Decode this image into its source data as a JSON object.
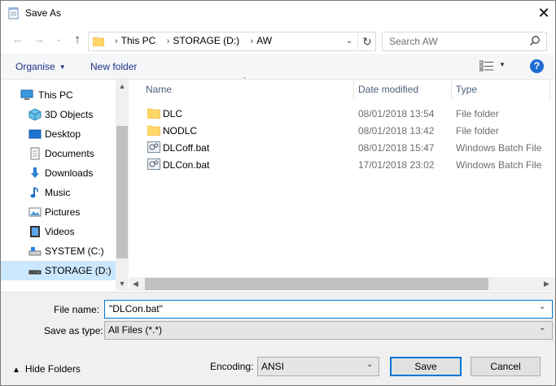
{
  "window": {
    "title": "Save As",
    "close_glyph": "✕"
  },
  "nav": {
    "back_glyph": "←",
    "forward_glyph": "→",
    "recent_glyph": "⌄",
    "up_glyph": "↑",
    "breadcrumbs": [
      "This PC",
      "STORAGE (D:)",
      "AW"
    ],
    "crumb_sep": "›",
    "search_placeholder": "Search AW"
  },
  "commands": {
    "organise": "Organise",
    "new_folder": "New folder"
  },
  "sidebar": {
    "items": [
      {
        "label": "This PC",
        "icon": "computer-icon",
        "selected": false
      },
      {
        "label": "3D Objects",
        "icon": "3d-objects-icon",
        "selected": false
      },
      {
        "label": "Desktop",
        "icon": "desktop-icon",
        "selected": false
      },
      {
        "label": "Documents",
        "icon": "documents-icon",
        "selected": false
      },
      {
        "label": "Downloads",
        "icon": "downloads-icon",
        "selected": false
      },
      {
        "label": "Music",
        "icon": "music-icon",
        "selected": false
      },
      {
        "label": "Pictures",
        "icon": "pictures-icon",
        "selected": false
      },
      {
        "label": "Videos",
        "icon": "videos-icon",
        "selected": false
      },
      {
        "label": "SYSTEM (C:)",
        "icon": "drive-c-icon",
        "selected": false
      },
      {
        "label": "STORAGE (D:)",
        "icon": "drive-d-icon",
        "selected": true
      }
    ]
  },
  "files": {
    "columns": [
      "Name",
      "Date modified",
      "Type"
    ],
    "rows": [
      {
        "name": "DLC",
        "date": "08/01/2018 13:54",
        "type": "File folder",
        "icon": "folder-icon"
      },
      {
        "name": "NODLC",
        "date": "08/01/2018 13:42",
        "type": "File folder",
        "icon": "folder-icon"
      },
      {
        "name": "DLCoff.bat",
        "date": "08/01/2018 15:47",
        "type": "Windows Batch File",
        "icon": "batch-file-icon"
      },
      {
        "name": "DLCon.bat",
        "date": "17/01/2018 23:02",
        "type": "Windows Batch File",
        "icon": "batch-file-icon"
      }
    ]
  },
  "form": {
    "file_name_label": "File name:",
    "file_name_value": "\"DLCon.bat\"",
    "save_type_label": "Save as type:",
    "save_type_value": "All Files  (*.*)",
    "hide_folders": "Hide Folders",
    "encoding_label": "Encoding:",
    "encoding_value": "ANSI",
    "save_button": "Save",
    "cancel_button": "Cancel"
  },
  "colors": {
    "accent": "#0078d7",
    "selected_bg": "#cce8ff",
    "folder": "#ffd669",
    "link": "#1e3287"
  }
}
